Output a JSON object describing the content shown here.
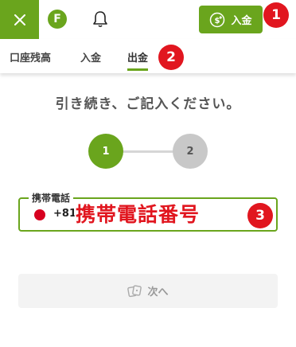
{
  "header": {
    "logo_letter": "F",
    "deposit_label": "入金"
  },
  "tabs": [
    {
      "label": "口座残高"
    },
    {
      "label": "入金"
    },
    {
      "label": "出金",
      "active": true
    }
  ],
  "main": {
    "heading": "引き続き、ご記入ください。",
    "steps": [
      "1",
      "2"
    ],
    "current_step": 1,
    "phone": {
      "label": "携帯電話",
      "dial_code": "+81"
    },
    "next_label": "次へ"
  },
  "annotations": {
    "phone_overlay": "携帯電話番号",
    "markers": [
      "1",
      "2",
      "3"
    ]
  },
  "colors": {
    "brand_green": "#6aa51d",
    "marker_red": "#e1161f",
    "inactive_step": "#c8c8c8"
  }
}
